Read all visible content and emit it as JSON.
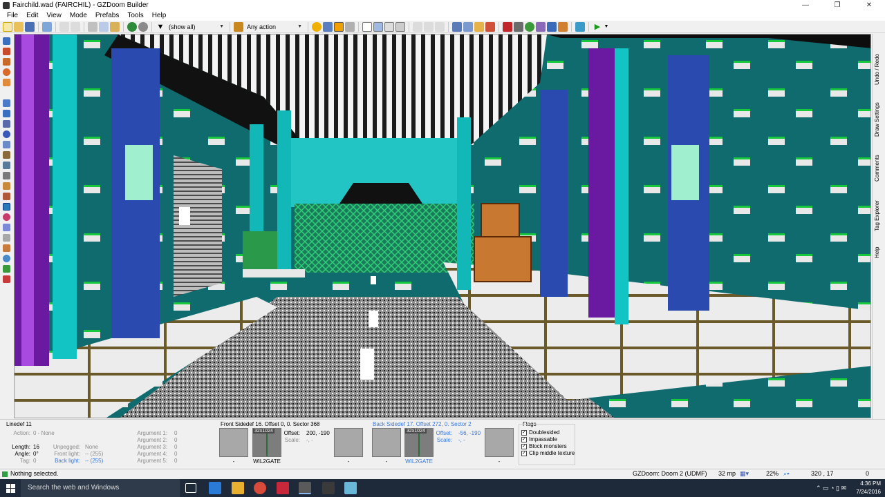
{
  "window": {
    "title": "Fairchild.wad (FAIRCHIL) - GZDoom Builder",
    "controls": [
      "—",
      "❐",
      "✕"
    ]
  },
  "menu": [
    "File",
    "Edit",
    "View",
    "Mode",
    "Prefabs",
    "Tools",
    "Help"
  ],
  "toolbar": {
    "filter_combo": "(show all)",
    "action_combo": "Any action"
  },
  "right_tabs": [
    "Undo / Redo",
    "Draw Settings",
    "Comments",
    "Tag Explorer",
    "Help"
  ],
  "linedef": {
    "title": "Linedef 11",
    "action_label": "Action:",
    "action_value": "0 - None",
    "length_label": "Length:",
    "length_value": "16",
    "angle_label": "Angle:",
    "angle_value": "0°",
    "tag_label": "Tag:",
    "tag_value": "0",
    "unpegged_label": "Unpegged:",
    "unpegged_value": "None",
    "front_light_label": "Front light:",
    "front_light_value": "-- (255)",
    "back_light_label": "Back light:",
    "back_light_value": "-- (255)",
    "arguments": [
      {
        "label": "Argument 1:",
        "value": "0"
      },
      {
        "label": "Argument 2:",
        "value": "0"
      },
      {
        "label": "Argument 3:",
        "value": "0"
      },
      {
        "label": "Argument 4:",
        "value": "0"
      },
      {
        "label": "Argument 5:",
        "value": "0"
      }
    ]
  },
  "front_sidedef": {
    "title": "Front Sidedef 16. Offset 0, 0. Sector 368",
    "upper_name": "-",
    "middle_size": "32x1024",
    "middle_name": "WIL2GATE",
    "lower_name": "-",
    "offset_label": "Offset:",
    "offset_value": "200, -190",
    "scale_label": "Scale:",
    "scale_value": "-, -"
  },
  "back_sidedef": {
    "title": "Back Sidedef 17. Offset 272, 0. Sector 2",
    "upper_name": "-",
    "middle_size": "32x1024",
    "middle_name": "WIL2GATE",
    "lower_name": "-",
    "offset_label": "Offset:",
    "offset_value": "-56, -190",
    "scale_label": "Scale:",
    "scale_value": "-, -"
  },
  "flags": {
    "title": "Flags",
    "items": [
      {
        "label": "Doublesided",
        "checked": true
      },
      {
        "label": "Impassable",
        "checked": true
      },
      {
        "label": "Block monsters",
        "checked": true
      },
      {
        "label": "Clip middle texture",
        "checked": true
      }
    ]
  },
  "status": {
    "message": "Nothing selected.",
    "engine": "GZDoom: Doom 2 (UDMF)",
    "grid": "32 mp",
    "zoom": "22%",
    "coords": "320 , 17",
    "extra": "0"
  },
  "taskbar": {
    "search_placeholder": "Search the web and Windows",
    "time": "4:36 PM",
    "date": "7/24/2016"
  }
}
